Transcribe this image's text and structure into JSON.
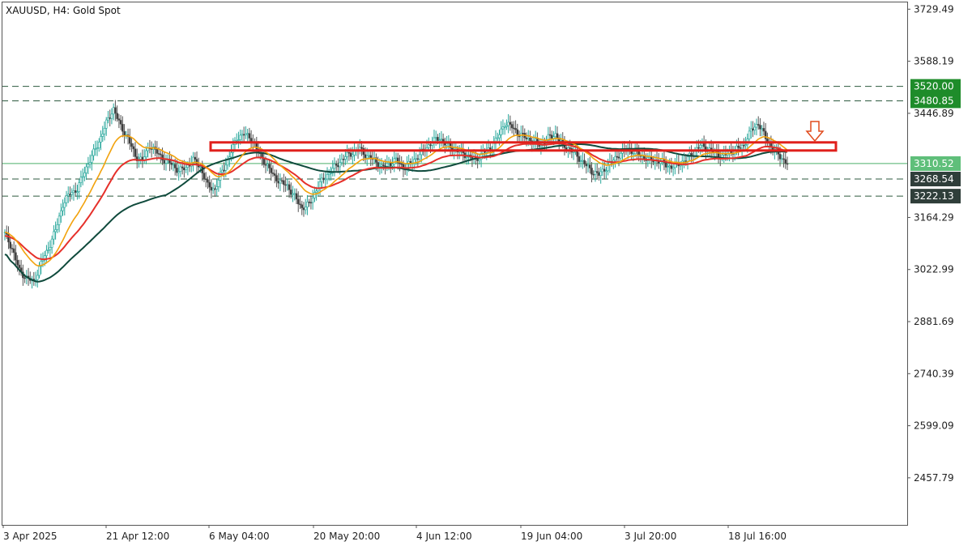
{
  "header": {
    "title": "XAUUSD, H4:  Gold Spot"
  },
  "chart_data": {
    "type": "candlestick",
    "symbol": "XAUUSD",
    "timeframe": "H4",
    "title": "XAUUSD, H4:  Gold Spot",
    "y_ticks": [
      "3729.49",
      "3588.19",
      "3446.89",
      "3164.29",
      "3022.99",
      "2881.69",
      "2740.39",
      "2599.09",
      "2457.79"
    ],
    "ylim": [
      2330,
      3750
    ],
    "x_ticks": [
      "3 Apr 2025",
      "21 Apr 12:00",
      "6 May 04:00",
      "20 May 20:00",
      "4 Jun 12:00",
      "19 Jun 04:00",
      "3 Jul 20:00",
      "18 Jul 16:00"
    ],
    "grid": false,
    "horizontal_levels": [
      {
        "price": 3520.0,
        "label": "3520.00",
        "style": "dashed",
        "tag_color": "#1e8c2a"
      },
      {
        "price": 3480.85,
        "label": "3480.85",
        "style": "dashed",
        "tag_color": "#1e8c2a"
      },
      {
        "price": 3310.52,
        "label": "3310.52",
        "style": "solid",
        "tag_color": "#5fbf7a"
      },
      {
        "price": 3268.54,
        "label": "3268.54",
        "style": "dashed",
        "tag_color": "#2f3e3a"
      },
      {
        "price": 3222.13,
        "label": "3222.13",
        "style": "dashed",
        "tag_color": "#2f3e3a"
      }
    ],
    "resistance_zone": {
      "price_top": 3368,
      "price_bottom": 3346,
      "color": "#e0201c"
    },
    "arrow": {
      "direction": "down",
      "color": "#e04a1c"
    },
    "closes": [
      3120,
      3080,
      3020,
      3000,
      2990,
      3040,
      3080,
      3130,
      3200,
      3230,
      3240,
      3290,
      3330,
      3370,
      3420,
      3460,
      3410,
      3380,
      3330,
      3320,
      3360,
      3340,
      3320,
      3310,
      3290,
      3300,
      3320,
      3300,
      3250,
      3240,
      3290,
      3330,
      3380,
      3390,
      3380,
      3340,
      3310,
      3280,
      3260,
      3250,
      3220,
      3190,
      3200,
      3240,
      3270,
      3290,
      3310,
      3330,
      3340,
      3350,
      3330,
      3320,
      3300,
      3310,
      3320,
      3300,
      3310,
      3330,
      3350,
      3370,
      3380,
      3360,
      3350,
      3340,
      3330,
      3320,
      3340,
      3350,
      3380,
      3420,
      3410,
      3390,
      3380,
      3370,
      3360,
      3380,
      3390,
      3360,
      3350,
      3330,
      3310,
      3290,
      3280,
      3300,
      3320,
      3340,
      3350,
      3340,
      3330,
      3320,
      3320,
      3310,
      3300,
      3310,
      3320,
      3340,
      3360,
      3350,
      3340,
      3330,
      3340,
      3350,
      3360,
      3400,
      3420,
      3380,
      3350,
      3330,
      3310
    ],
    "ma_fast_color": "#f2a20c",
    "ma_mid_color": "#e6302a",
    "ma_slow_color": "#0f4a3c"
  }
}
